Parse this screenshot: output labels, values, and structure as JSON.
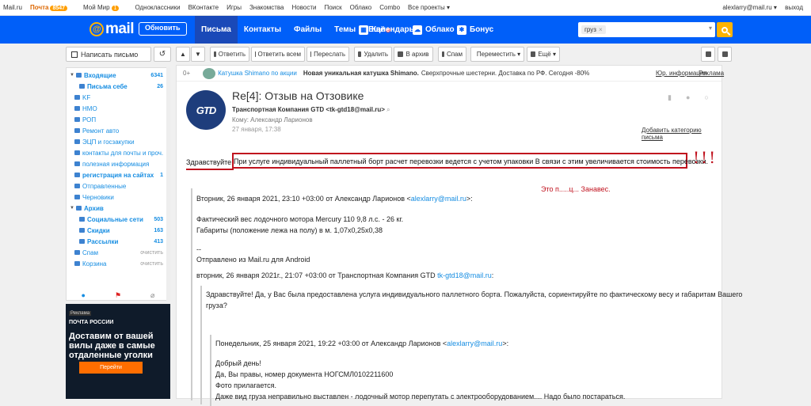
{
  "portal": {
    "items": [
      "Mail.ru",
      "Почта",
      "Мой Мир",
      "Одноклассники",
      "ВКонтакте",
      "Игры",
      "Знакомства",
      "Новости",
      "Поиск",
      "Облако",
      "Combo",
      "Все проекты ▾"
    ],
    "mail_badge": "8547",
    "myworld_badge": "1",
    "user": "alexlarry@mail.ru ▾",
    "exit": "выход"
  },
  "header": {
    "logo": "mail",
    "refresh_label": "Обновить",
    "nav": [
      "Письма",
      "Контакты",
      "Файлы",
      "Темы",
      "Ещё"
    ],
    "services": [
      "Календарь",
      "Облако",
      "Бонус"
    ],
    "search_chip": "груз"
  },
  "sidebar": {
    "write_label": "Написать письмо",
    "folders": [
      {
        "label": "Входящие",
        "count": "6341"
      },
      {
        "label": "Письма себе",
        "count": "26"
      },
      {
        "label": "KF",
        "count": ""
      },
      {
        "label": "НМО",
        "count": ""
      },
      {
        "label": "РОП",
        "count": ""
      },
      {
        "label": "Ремонт авто",
        "count": ""
      },
      {
        "label": "ЭЦП и госзакупки",
        "count": ""
      },
      {
        "label": "контакты для почты и проч.",
        "count": ""
      },
      {
        "label": "полезная информация",
        "count": ""
      },
      {
        "label": "регистрация на сайтах",
        "count": "1"
      },
      {
        "label": "Отправленные",
        "count": ""
      },
      {
        "label": "Черновики",
        "count": ""
      },
      {
        "label": "Архив",
        "count": ""
      },
      {
        "label": "Социальные сети",
        "count": "503"
      },
      {
        "label": "Скидки",
        "count": "163"
      },
      {
        "label": "Рассылки",
        "count": "413"
      },
      {
        "label": "Спам",
        "count": "очистить"
      },
      {
        "label": "Корзина",
        "count": "очистить"
      }
    ],
    "ad": {
      "label": "Реклама",
      "brand": "ПОЧТА РОССИИ",
      "title": "Доставим от вашей вилы даже в самые отдаленные уголки",
      "button": "Перейти"
    }
  },
  "toolbar": {
    "reply": "Ответить",
    "reply_all": "Ответить всем",
    "forward": "Переслать",
    "delete": "Удалить",
    "archive": "В архив",
    "spam": "Спам",
    "move": "Переместить ▾",
    "more": "Ещё ▾"
  },
  "adrow": {
    "count": "0+",
    "sender": "Катушка Shimano по акции",
    "text_bold": "Новая уникальная катушка Shimano.",
    "text": "Сверхпрочные шестерни. Доставка по РФ. Сегодня -80%",
    "info": "Юр. информация",
    "ad": "Реклама"
  },
  "message": {
    "subject": "Re[4]: Отзыв на Отзовике",
    "from": "Транспортная Компания GTD <tk-gtd18@mail.ru>",
    "to_label": "Кому:",
    "to": "Александр Ларионов",
    "date": "27 января, 17:38",
    "add_category": "Добавить категорию письма",
    "greeting": "Здравствуйте!",
    "highlight": "При услуге индивидуальный паллетный борт расчет перевозки ведется с учетом упаковки В связи с этим увеличивается стоимость перевозки.",
    "exclaim": "!!!",
    "annotation": "Это п.....ц... Занавес.",
    "q1_header_pre": "Вторник, 26 января 2021, 23:10 +03:00 от Александр Ларионов <",
    "q1_email": "alexlarry@mail.ru",
    "q1_header_post": ">:",
    "q1_line1": "Фактический вес лодочного мотора Mercury 110 9,8 л.с. - 26 кг.",
    "q1_line2": "Габариты (положение лежа на полу) в м. 1,07х0,25х0,38",
    "sig_dash": "--",
    "sig": "Отправлено из Mail.ru для Android",
    "q2_header_pre": "вторник, 26 января 2021г., 21:07 +03:00 от Транспортная Компания GTD ",
    "q2_email": "tk-gtd18@mail.ru",
    "q2_header_post": ":",
    "q2_line1": "Здравствуйте! Да, у Вас была предоставлена услуга индивидуального паллетного борта. Пожалуйста, сориентируйте по фактическому весу и габаритам Вашего",
    "q2_line2": "груза?",
    "q3_header_pre": "Понедельник, 25 января 2021, 19:22 +03:00 от Александр Ларионов <",
    "q3_email": "alexlarry@mail.ru",
    "q3_header_post": ">:",
    "q3_line1": "Добрый день!",
    "q3_line2": "Да, Вы правы, номер документа НОГСМЛ0102211600",
    "q3_line3": "Фото прилагается.",
    "q3_line4": "Даже вид груза неправильно выставлен - лодочный мотор перепутать с электрооборудованием.... Надо было постараться."
  }
}
